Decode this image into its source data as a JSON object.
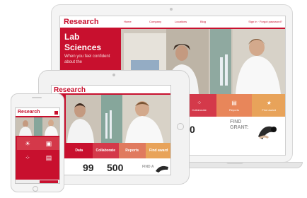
{
  "colors": {
    "brand": "#c8102e",
    "tile_orange": "#e8865a",
    "tile_red": "#d4394a"
  },
  "laptop": {
    "logo": "Research",
    "nav": [
      "Home",
      "Company",
      "Locations",
      "Blog"
    ],
    "sign_in": "Sign in · Forgot password?",
    "hero": {
      "title_line1": "Lab",
      "title_line2": "Sciences",
      "subtitle": "When you feel confident about the"
    },
    "tiles": [
      {
        "label": "Collaborate",
        "icon": "network-icon"
      },
      {
        "label": "Reports",
        "icon": "chart-icon"
      },
      {
        "label": "Find award",
        "icon": "trophy-icon"
      }
    ],
    "stat": "0",
    "find_line1": "FIND",
    "find_line2": "GRANT:"
  },
  "tablet": {
    "logo": "Research",
    "tiles": [
      {
        "label": "Data"
      },
      {
        "label": "Collaborate"
      },
      {
        "label": "Reports"
      },
      {
        "label": "Find award"
      }
    ],
    "stat1": "99",
    "stat2": "500",
    "find": "FIND A"
  },
  "phone": {
    "logo": "Research"
  }
}
